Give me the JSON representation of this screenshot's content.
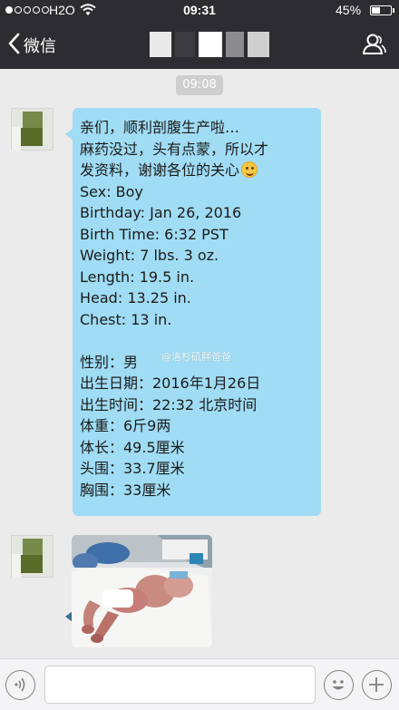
{
  "status_bar": {
    "carrier": "H2O",
    "time": "09:31",
    "battery": "45%",
    "battery_level": 0.45,
    "signal_dots_filled": 1,
    "signal_dots_total": 5
  },
  "nav": {
    "back_label": "微信",
    "title_obscured": true
  },
  "chat": {
    "timestamp": "09:08",
    "message": {
      "lines": [
        "亲们，顺利剖腹生产啦…",
        "麻药没过，头有点蒙，所以才",
        "发资料，谢谢各位的关心",
        "Sex: Boy",
        "Birthday: Jan 26, 2016",
        "Birth Time: 6:32 PST",
        "Weight: 7 lbs. 3 oz.",
        "Length: 19.5 in.",
        "Head: 13.25 in.",
        "Chest: 13 in.",
        "",
        "性别：男",
        "出生日期：2016年1月26日",
        "出生时间：22:32 北京时间",
        "体重：6斤9两",
        "体长：49.5厘米",
        "头围：33.7厘米",
        "胸围：33厘米"
      ],
      "emoji": "grinning-face-emoji"
    },
    "watermark": "@洛杉矶胖爸爸"
  },
  "input_bar": {
    "placeholder": ""
  },
  "colors": {
    "bar_background": "#2d2d31",
    "chat_background": "#ebebeb",
    "bubble": "#a0dcf4",
    "timestamp_badge": "#cecece"
  },
  "icons": {
    "back": "chevron-left-icon",
    "contact": "person-icon",
    "voice": "voice-icon",
    "emoji": "smiley-icon",
    "plus": "plus-icon",
    "wifi": "wifi-icon"
  }
}
